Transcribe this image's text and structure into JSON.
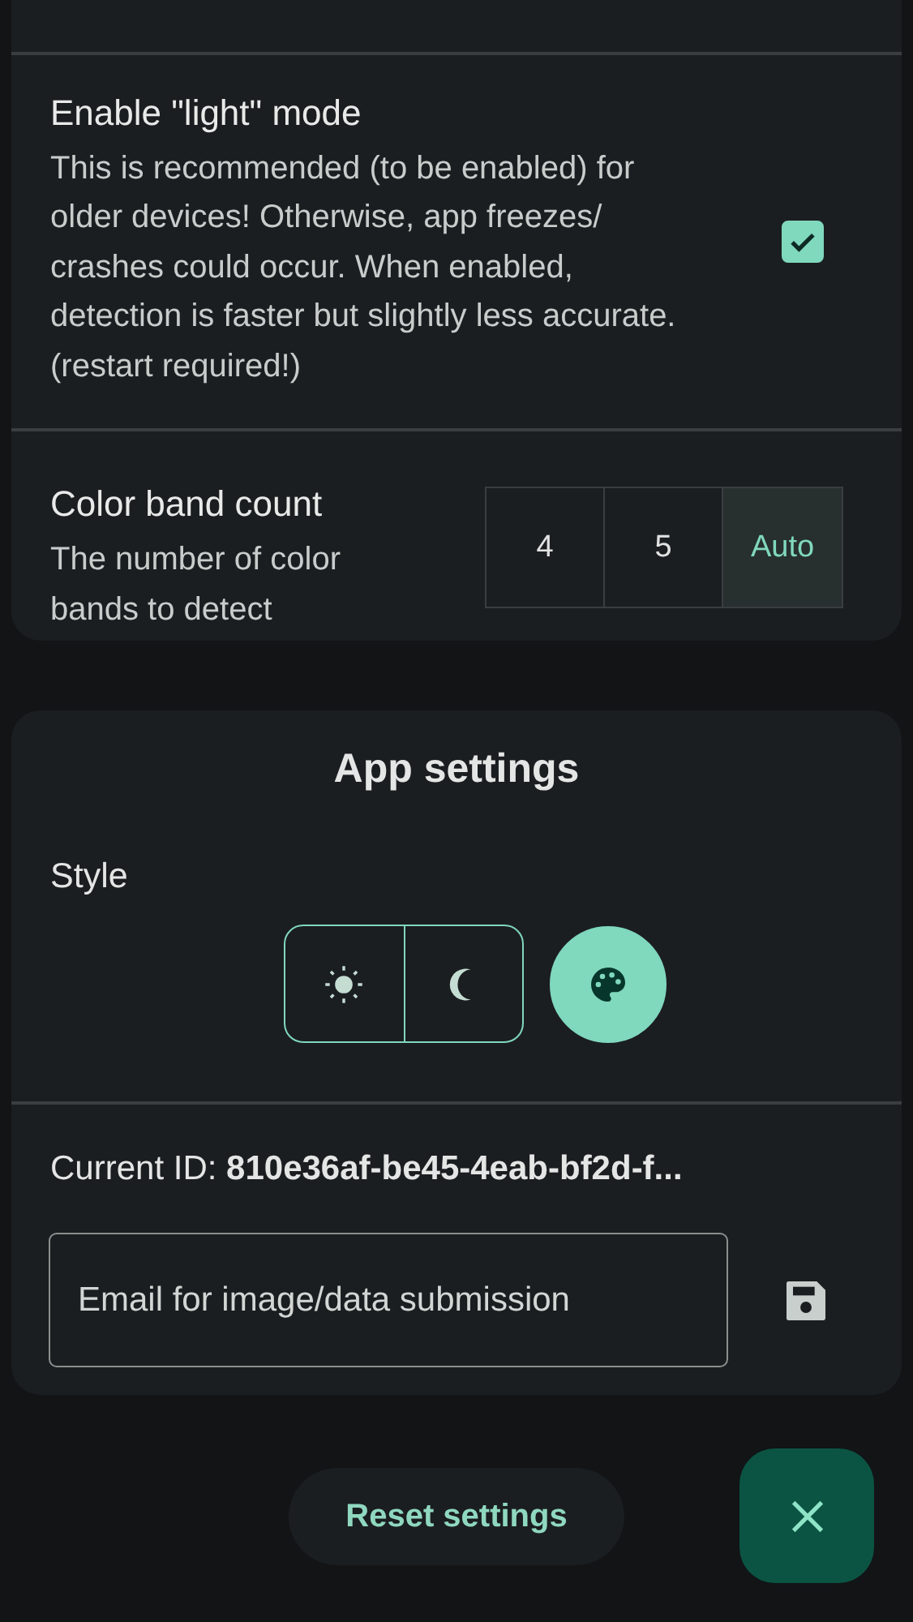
{
  "detection_settings": [
    {
      "kind": "checkbox",
      "title": "Enable \"light\" mode",
      "description": "This is recommended (to be enabled) for older devices! Otherwise, app freezes/ crashes could occur. When enabled, detection is faster but slightly less accurate. (restart required!)",
      "checked": true
    },
    {
      "kind": "segmented",
      "title": "Color band count",
      "description": "The number of color bands to detect",
      "options": [
        {
          "label": "4",
          "selected": false
        },
        {
          "label": "5",
          "selected": false
        },
        {
          "label": "Auto",
          "selected": true
        }
      ]
    }
  ],
  "app_settings": {
    "title": "App settings",
    "style": {
      "label": "Style",
      "options": [
        {
          "kind": "light",
          "selected": false
        },
        {
          "kind": "dark",
          "selected": false
        },
        {
          "kind": "dynamic",
          "selected": true
        }
      ]
    },
    "current_id": {
      "label": "Current ID:",
      "value": "810e36af-be45-4eab-bf2d-f..."
    },
    "email": {
      "placeholder": "Email for image/data submission"
    }
  },
  "reset_button": "Reset settings"
}
